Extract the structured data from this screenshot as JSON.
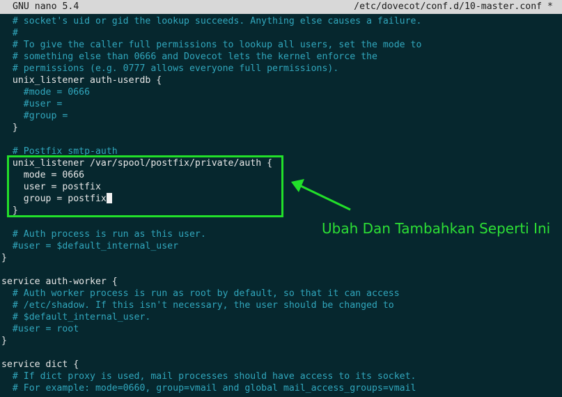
{
  "titlebar": {
    "app_name": "GNU nano 5.4",
    "file_path": "/etc/dovecot/conf.d/10-master.conf *"
  },
  "lines": [
    {
      "text": "  # socket's uid or gid the lookup succeeds. Anything else causes a failure.",
      "kind": "comment"
    },
    {
      "text": "  #",
      "kind": "comment"
    },
    {
      "text": "  # To give the caller full permissions to lookup all users, set the mode to",
      "kind": "comment"
    },
    {
      "text": "  # something else than 0666 and Dovecot lets the kernel enforce the",
      "kind": "comment"
    },
    {
      "text": "  # permissions (e.g. 0777 allows everyone full permissions).",
      "kind": "comment"
    },
    {
      "text": "  unix_listener auth-userdb {",
      "kind": "code"
    },
    {
      "text": "    #mode = 0666",
      "kind": "comment"
    },
    {
      "text": "    #user =",
      "kind": "comment"
    },
    {
      "text": "    #group =",
      "kind": "comment"
    },
    {
      "text": "  }",
      "kind": "code"
    },
    {
      "text": "",
      "kind": "code"
    },
    {
      "text": "  # Postfix smtp-auth",
      "kind": "comment"
    },
    {
      "text": "  unix_listener /var/spool/postfix/private/auth {",
      "kind": "code"
    },
    {
      "text": "    mode = 0666",
      "kind": "code"
    },
    {
      "text": "    user = postfix",
      "kind": "code"
    },
    {
      "text": "    group = postfix",
      "kind": "code",
      "cursor": true
    },
    {
      "text": "  }",
      "kind": "code"
    },
    {
      "text": "",
      "kind": "code"
    },
    {
      "text": "  # Auth process is run as this user.",
      "kind": "comment"
    },
    {
      "text": "  #user = $default_internal_user",
      "kind": "comment"
    },
    {
      "text": "}",
      "kind": "code"
    },
    {
      "text": "",
      "kind": "code"
    },
    {
      "text": "service auth-worker {",
      "kind": "code"
    },
    {
      "text": "  # Auth worker process is run as root by default, so that it can access",
      "kind": "comment"
    },
    {
      "text": "  # /etc/shadow. If this isn't necessary, the user should be changed to",
      "kind": "comment"
    },
    {
      "text": "  # $default_internal_user.",
      "kind": "comment"
    },
    {
      "text": "  #user = root",
      "kind": "comment"
    },
    {
      "text": "}",
      "kind": "code"
    },
    {
      "text": "",
      "kind": "code"
    },
    {
      "text": "service dict {",
      "kind": "code"
    },
    {
      "text": "  # If dict proxy is used, mail processes should have access to its socket.",
      "kind": "comment"
    },
    {
      "text": "  # For example: mode=0660, group=vmail and global mail_access_groups=vmail",
      "kind": "comment"
    }
  ],
  "annotation": {
    "text": "Ubah Dan Tambahkan Seperti Ini",
    "color": "#2de035"
  }
}
